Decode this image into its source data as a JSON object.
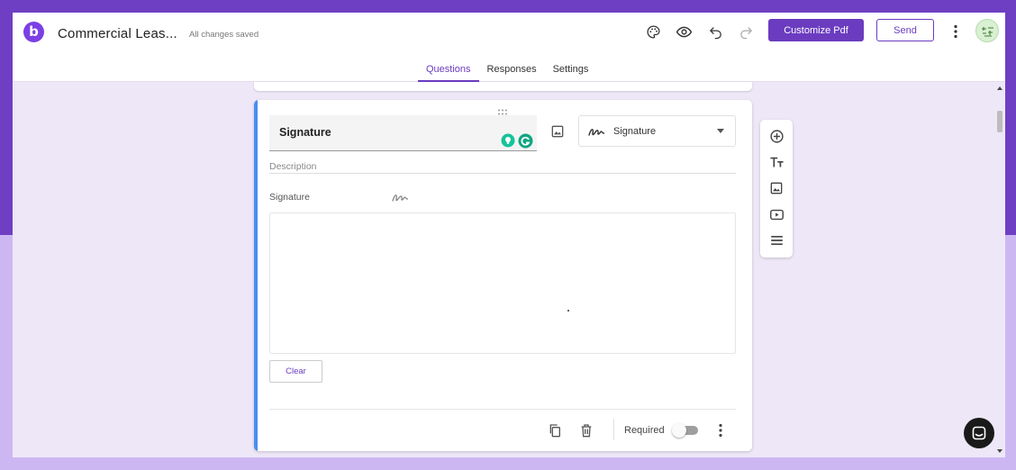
{
  "header": {
    "logo_letter": "b",
    "doc_title": "Commercial Leas...",
    "save_status": "All changes saved",
    "customize_label": "Customize Pdf",
    "send_label": "Send"
  },
  "tabs": [
    {
      "label": "Questions",
      "active": true
    },
    {
      "label": "Responses",
      "active": false
    },
    {
      "label": "Settings",
      "active": false
    }
  ],
  "question": {
    "title": "Signature",
    "type_label": "Signature",
    "description_placeholder": "Description",
    "signature_label": "Signature",
    "clear_label": "Clear",
    "required_label": "Required",
    "required": false
  },
  "colors": {
    "brand": "#6b3cc0",
    "accent_bar": "#4a8ef0",
    "background_top": "#6e3fc2",
    "background_bottom": "#cdb7f2",
    "canvas": "#ede7f7"
  },
  "icons": {
    "header": [
      "palette-icon",
      "preview-eye-icon",
      "undo-icon",
      "redo-icon",
      "more-vert-icon"
    ],
    "sidebar_tools": [
      "add-question-icon",
      "add-title-text-icon",
      "add-image-icon",
      "add-video-icon",
      "add-section-icon"
    ],
    "footer": [
      "duplicate-icon",
      "delete-icon",
      "more-vert-icon"
    ]
  }
}
